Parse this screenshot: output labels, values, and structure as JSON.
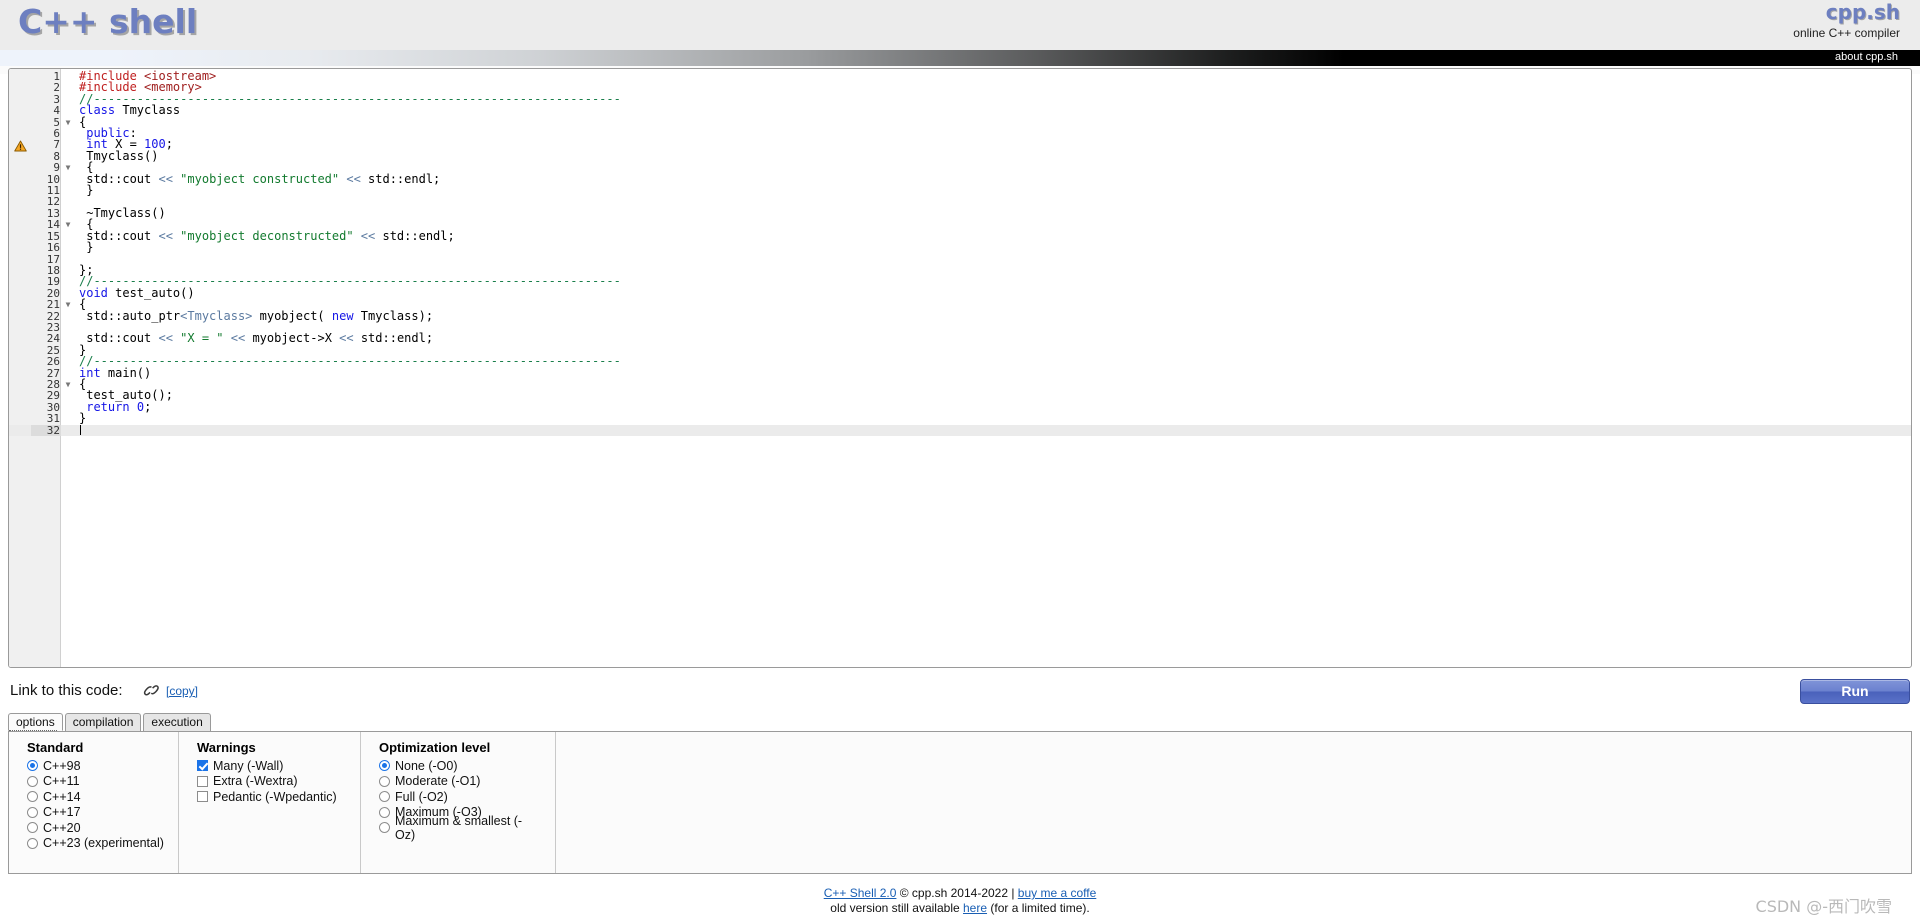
{
  "header": {
    "logo": "C++ shell",
    "brand": "cpp.sh",
    "tagline": "online C++ compiler",
    "about_link": "about cpp.sh",
    "accent_color": "#6d7fc0"
  },
  "editor": {
    "active_line": 32,
    "warning_line": 7,
    "fold_lines": [
      5,
      9,
      14,
      21,
      28
    ],
    "lines": [
      {
        "n": 1,
        "tokens": [
          {
            "t": "#include ",
            "c": "pre"
          },
          {
            "t": "<iostream>",
            "c": "inc"
          }
        ]
      },
      {
        "n": 2,
        "tokens": [
          {
            "t": "#include ",
            "c": "pre"
          },
          {
            "t": "<memory>",
            "c": "inc"
          }
        ]
      },
      {
        "n": 3,
        "tokens": [
          {
            "t": "//-------------------------------------------------------------------------",
            "c": "com"
          }
        ]
      },
      {
        "n": 4,
        "tokens": [
          {
            "t": "class",
            "c": "kw"
          },
          {
            "t": " Tmyclass",
            "c": ""
          }
        ]
      },
      {
        "n": 5,
        "tokens": [
          {
            "t": "{",
            "c": ""
          }
        ]
      },
      {
        "n": 6,
        "tokens": [
          {
            "t": " ",
            "c": ""
          },
          {
            "t": "public",
            "c": "kw"
          },
          {
            "t": ":",
            "c": ""
          }
        ]
      },
      {
        "n": 7,
        "tokens": [
          {
            "t": " ",
            "c": ""
          },
          {
            "t": "int",
            "c": "kw"
          },
          {
            "t": " X = ",
            "c": ""
          },
          {
            "t": "100",
            "c": "num"
          },
          {
            "t": ";",
            "c": ""
          }
        ]
      },
      {
        "n": 8,
        "tokens": [
          {
            "t": " Tmyclass()",
            "c": ""
          }
        ]
      },
      {
        "n": 9,
        "tokens": [
          {
            "t": " {",
            "c": ""
          }
        ]
      },
      {
        "n": 10,
        "tokens": [
          {
            "t": " std::cout ",
            "c": ""
          },
          {
            "t": "<<",
            "c": "op"
          },
          {
            "t": " ",
            "c": ""
          },
          {
            "t": "\"myobject constructed\"",
            "c": "str"
          },
          {
            "t": " ",
            "c": ""
          },
          {
            "t": "<<",
            "c": "op"
          },
          {
            "t": " std::endl;",
            "c": ""
          }
        ]
      },
      {
        "n": 11,
        "tokens": [
          {
            "t": " }",
            "c": ""
          }
        ]
      },
      {
        "n": 12,
        "tokens": []
      },
      {
        "n": 13,
        "tokens": [
          {
            "t": " ~Tmyclass()",
            "c": ""
          }
        ]
      },
      {
        "n": 14,
        "tokens": [
          {
            "t": " {",
            "c": ""
          }
        ]
      },
      {
        "n": 15,
        "tokens": [
          {
            "t": " std::cout ",
            "c": ""
          },
          {
            "t": "<<",
            "c": "op"
          },
          {
            "t": " ",
            "c": ""
          },
          {
            "t": "\"myobject deconstructed\"",
            "c": "str"
          },
          {
            "t": " ",
            "c": ""
          },
          {
            "t": "<<",
            "c": "op"
          },
          {
            "t": " std::endl;",
            "c": ""
          }
        ]
      },
      {
        "n": 16,
        "tokens": [
          {
            "t": " }",
            "c": ""
          }
        ]
      },
      {
        "n": 17,
        "tokens": []
      },
      {
        "n": 18,
        "tokens": [
          {
            "t": "};",
            "c": ""
          }
        ]
      },
      {
        "n": 19,
        "tokens": [
          {
            "t": "//-------------------------------------------------------------------------",
            "c": "com"
          }
        ]
      },
      {
        "n": 20,
        "tokens": [
          {
            "t": "void",
            "c": "kw"
          },
          {
            "t": " test_auto()",
            "c": ""
          }
        ]
      },
      {
        "n": 21,
        "tokens": [
          {
            "t": "{",
            "c": ""
          }
        ]
      },
      {
        "n": 22,
        "tokens": [
          {
            "t": " std::auto_ptr",
            "c": ""
          },
          {
            "t": "<Tmyclass>",
            "c": "op"
          },
          {
            "t": " myobject( ",
            "c": ""
          },
          {
            "t": "new",
            "c": "kw"
          },
          {
            "t": " Tmyclass);",
            "c": ""
          }
        ]
      },
      {
        "n": 23,
        "tokens": []
      },
      {
        "n": 24,
        "tokens": [
          {
            "t": " std::cout ",
            "c": ""
          },
          {
            "t": "<<",
            "c": "op"
          },
          {
            "t": " ",
            "c": ""
          },
          {
            "t": "\"X = \"",
            "c": "str"
          },
          {
            "t": " ",
            "c": ""
          },
          {
            "t": "<<",
            "c": "op"
          },
          {
            "t": " myobject->X ",
            "c": ""
          },
          {
            "t": "<<",
            "c": "op"
          },
          {
            "t": " std::endl;",
            "c": ""
          }
        ]
      },
      {
        "n": 25,
        "tokens": [
          {
            "t": "}",
            "c": ""
          }
        ]
      },
      {
        "n": 26,
        "tokens": [
          {
            "t": "//-------------------------------------------------------------------------",
            "c": "com"
          }
        ]
      },
      {
        "n": 27,
        "tokens": [
          {
            "t": "int",
            "c": "kw"
          },
          {
            "t": " main()",
            "c": ""
          }
        ]
      },
      {
        "n": 28,
        "tokens": [
          {
            "t": "{",
            "c": ""
          }
        ]
      },
      {
        "n": 29,
        "tokens": [
          {
            "t": " test_auto();",
            "c": ""
          }
        ]
      },
      {
        "n": 30,
        "tokens": [
          {
            "t": " ",
            "c": ""
          },
          {
            "t": "return",
            "c": "kw"
          },
          {
            "t": " ",
            "c": ""
          },
          {
            "t": "0",
            "c": "num"
          },
          {
            "t": ";",
            "c": ""
          }
        ]
      },
      {
        "n": 31,
        "tokens": [
          {
            "t": "}",
            "c": ""
          }
        ]
      },
      {
        "n": 32,
        "tokens": []
      }
    ]
  },
  "linkrow": {
    "label": "Link to this code:",
    "chain_icon": "⚭",
    "copy_label": "[copy]",
    "run_label": "Run"
  },
  "tabs": [
    {
      "label": "options",
      "selected": true
    },
    {
      "label": "compilation",
      "selected": false
    },
    {
      "label": "execution",
      "selected": false
    }
  ],
  "options": {
    "standard": {
      "title": "Standard",
      "items": [
        {
          "label": "C++98",
          "selected": true
        },
        {
          "label": "C++11",
          "selected": false
        },
        {
          "label": "C++14",
          "selected": false
        },
        {
          "label": "C++17",
          "selected": false
        },
        {
          "label": "C++20",
          "selected": false
        },
        {
          "label": "C++23 (experimental)",
          "selected": false
        }
      ]
    },
    "warnings": {
      "title": "Warnings",
      "items": [
        {
          "label": "Many (-Wall)",
          "checked": true
        },
        {
          "label": "Extra (-Wextra)",
          "checked": false
        },
        {
          "label": "Pedantic (-Wpedantic)",
          "checked": false
        }
      ]
    },
    "optimization": {
      "title": "Optimization level",
      "items": [
        {
          "label": "None (-O0)",
          "selected": true
        },
        {
          "label": "Moderate (-O1)",
          "selected": false
        },
        {
          "label": "Full (-O2)",
          "selected": false
        },
        {
          "label": "Maximum (-O3)",
          "selected": false
        },
        {
          "label": "Maximum & smallest (-Oz)",
          "selected": false
        }
      ]
    }
  },
  "footer": {
    "line1_link1": "C++ Shell 2.0",
    "line1_mid": " © cpp.sh 2014-2022 | ",
    "line1_link2": "buy me a coffe",
    "line2_pre": "old version still available ",
    "line2_link": "here",
    "line2_post": " (for a limited time)."
  },
  "watermark": "CSDN @-西门吹雪"
}
